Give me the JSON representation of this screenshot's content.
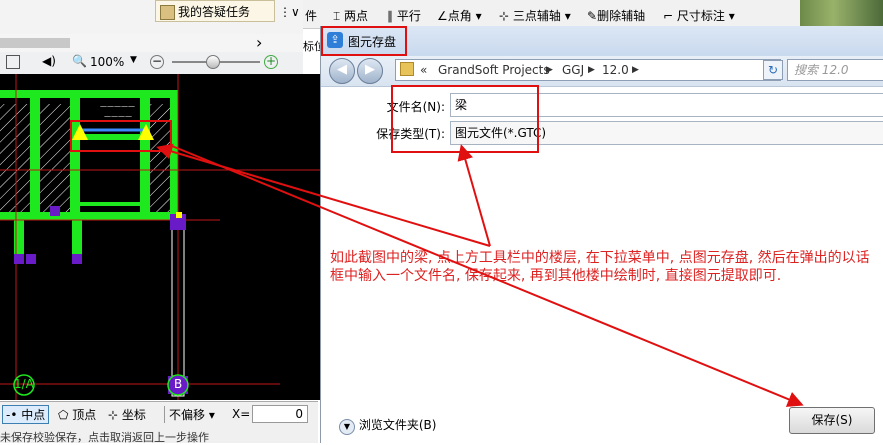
{
  "app": {
    "task_tab": "我的答疑任务",
    "zoom": "100%",
    "cad_toolbar": {
      "fragment": "件",
      "two_points": "两点",
      "parallel": "平行",
      "angle": "点角",
      "three_point_aux": "三点辅轴",
      "delete_aux": "删除辅轴",
      "dimension": "尺寸标注"
    },
    "side_fragment": "标位",
    "snap": {
      "midpoint": "中点",
      "vertex": "顶点",
      "coordinate": "坐标",
      "offset": "不偏移",
      "x_label": "X=",
      "x_value": "0"
    },
    "status_text": "未保存校验保存，点击取消返回上一步操作",
    "axis_a": "1/A",
    "axis_b": "B"
  },
  "dialog": {
    "title": "图元存盘",
    "breadcrumb": [
      "GrandSoft Projects",
      "GGJ",
      "12.0"
    ],
    "search_placeholder": "搜索 12.0",
    "filename_label": "文件名(N):",
    "filename_value": "梁",
    "filetype_label": "保存类型(T):",
    "filetype_value": "图元文件(*.GTC)",
    "browse_label": "浏览文件夹(B)",
    "save_label": "保存(S)"
  },
  "annotation": "如此截图中的梁, 点上方工具栏中的楼层, 在下拉菜单中, 点图元存盘, 然后在弹出的以话框中输入一个文件名, 保存起来, 再到其他楼中绘制时, 直接图元提取即可.",
  "colors": {
    "beam": "#1ee81e",
    "column": "#6a1bc8",
    "marker": "#ffff00",
    "annotation": "#dd2222"
  }
}
